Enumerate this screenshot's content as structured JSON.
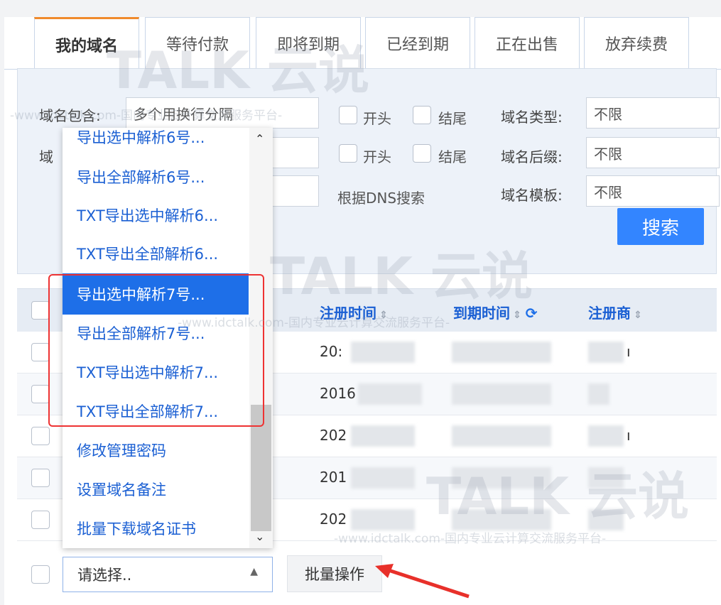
{
  "tabs": [
    "我的域名",
    "等待付款",
    "即将到期",
    "已经到期",
    "正在出售",
    "放弃续费"
  ],
  "filter": {
    "domain_contains_label": "域名包含:",
    "domain_contains_placeholder": "多个用换行分隔",
    "label2_partial": "域",
    "start_label": "开头",
    "end_label": "结尾",
    "dns_search_label": "根据DNS搜索",
    "type_label": "域名类型:",
    "type_value": "不限",
    "suffix_label": "域名后缀:",
    "suffix_value": "不限",
    "template_label": "域名模板:",
    "template_value": "不限",
    "search_button": "搜索"
  },
  "table": {
    "col_reg": "注册时间",
    "col_exp": "到期时间",
    "col_registrar": "注册商",
    "rows": [
      {
        "reg": "20:",
        "registrar_tail": "ı"
      },
      {
        "reg": "2016",
        "registrar_tail": ""
      },
      {
        "reg": "202",
        "registrar_tail": "ı"
      },
      {
        "reg": "201",
        "registrar_tail": ""
      },
      {
        "reg": "202",
        "registrar_tail": ""
      }
    ]
  },
  "dropdown": {
    "items": [
      "导出选中解析6号...",
      "导出全部解析6号...",
      "TXT导出选中解析6...",
      "TXT导出全部解析6...",
      "导出选中解析7号...",
      "导出全部解析7号...",
      "TXT导出选中解析7...",
      "TXT导出全部解析7...",
      "修改管理密码",
      "设置域名备注",
      "批量下载域名证书"
    ]
  },
  "bottom": {
    "select_value": "请选择..",
    "batch_button": "批量操作"
  },
  "watermark": {
    "brand": "TALK 云说",
    "url": "-www.idctalk.com-国内专业云计算交流服务平台-"
  }
}
